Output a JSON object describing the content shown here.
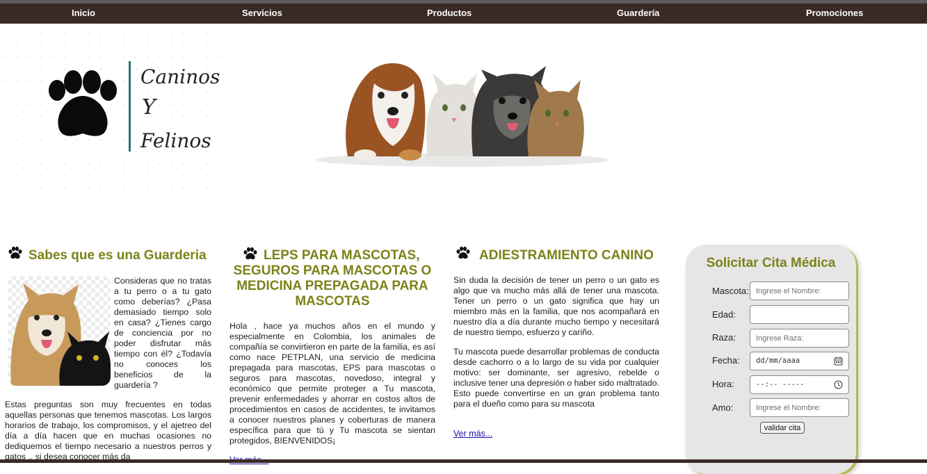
{
  "nav": {
    "items": [
      "Inicio",
      "Servicios",
      "Productos",
      "Guardería",
      "Promociones"
    ]
  },
  "logo": {
    "text_line1": "Caninos",
    "text_line2": "Y",
    "text_line3": "Felinos"
  },
  "colors": {
    "nav_bg": "#3a2a25",
    "heading_olive": "#7c8218",
    "card_bg": "#e6e6e6",
    "link": "#1a0dab"
  },
  "col1": {
    "icon": "paw-icon",
    "title": "Sabes que es una Guarderia",
    "intro": "Consideras que no tratas a tu perro o a tu gato como deberías? ¿Pasa demasiado tiempo solo en casa? ¿Tienes cargo de conciencia por no poder disfrutar más tiempo con él? ¿Todavía no conoces los beneficios de la guardería ?",
    "body": "Estas preguntas son muy frecuentes en todas aquellas personas que tenemos mascotas. Los largos horarios de trabajo, los compromisos, y el ajetreo del día a día hacen que en muchas ocasiones no dediquemos el tiempo necesario a nuestros perros y gatos .. si desea conocer más da"
  },
  "col2": {
    "icon": "paw-icon",
    "title_line1": "LEPS PARA MASCOTAS,",
    "title_rest": "SEGUROS PARA MASCOTAS O MEDICINA PREPAGADA PARA MASCOTAS",
    "body": "Hola , hace ya muchos años en el mundo y especialmente en Colombia, los animales de compañía se convirtieron en parte de la familia, es así como nace PETPLAN, una servicio de medicina prepagada para mascotas, EPS para mascotas o seguros para mascotas, novedoso, integral y económico que permite proteger a Tu mascota, prevenir enfermedades y ahorrar en costos altos de procedimientos en casos de accidentes, te invitamos a conocer nuestros planes y coberturas de manera específica para que tú y Tu mascota se sientan protegidos, BIENVENIDOS¡",
    "link": "Ver más..."
  },
  "col3": {
    "icon": "paw-icon",
    "title": "ADIESTRAMIENTO CANINO",
    "p1": "Sin duda la decisión de tener un perro o un gato es algo que va mucho más allá de tener una mascota. Tener un perro o un gato significa que hay un miembro más en la familia, que nos acompañará en nuestro día a día durante mucho tiempo y necesitará de nuestro tiempo, esfuerzo y cariño.",
    "p2": "Tu mascota puede desarrollar problemas de conducta desde cachorro o a lo largo de su vida por cualquier motivo: ser dominante, ser agresivo, rebelde o inclusive tener una depresión o haber sido maltratado. Esto puede convertirse en un gran problema tanto para el dueño como para su mascota",
    "link": "Ver más..."
  },
  "form": {
    "title": "Solicitar Cita Médica",
    "fields": [
      {
        "label": "Mascota:",
        "placeholder": "Ingrese el Nombre:"
      },
      {
        "label": "Edad:",
        "placeholder": ""
      },
      {
        "label": "Raza:",
        "placeholder": "Ingrese Raza:"
      },
      {
        "label": "Fecha:",
        "value": "dd/mm/aaaa",
        "icon": "calendar-icon"
      },
      {
        "label": "Hora:",
        "value": "--:-- -----",
        "icon": "clock-icon"
      },
      {
        "label": "Amo:",
        "placeholder": "Ingrese el Nombre:"
      }
    ],
    "submit": "validar cita"
  }
}
